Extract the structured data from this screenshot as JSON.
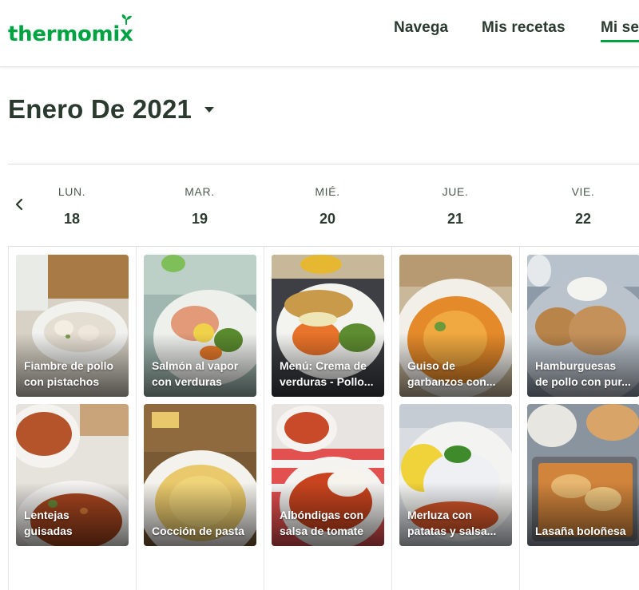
{
  "header": {
    "logo": "thermomix",
    "nav": [
      {
        "label": "Navega",
        "active": false
      },
      {
        "label": "Mis recetas",
        "active": false
      },
      {
        "label": "Mi se",
        "active": true
      }
    ]
  },
  "calendar": {
    "month_title": "Enero De 2021",
    "days": [
      {
        "name": "LUN.",
        "number": "18"
      },
      {
        "name": "MAR.",
        "number": "19"
      },
      {
        "name": "MIÉ.",
        "number": "20"
      },
      {
        "name": "JUE.",
        "number": "21"
      },
      {
        "name": "VIE.",
        "number": "22"
      }
    ],
    "recipes": [
      [
        {
          "line1": "Fiambre de pollo",
          "line2": "con pistachos"
        },
        {
          "line1": "Lentejas",
          "line2": "guisadas"
        }
      ],
      [
        {
          "line1": "Salmón al vapor",
          "line2": "con verduras"
        },
        {
          "line1": "Cocción de pasta",
          "line2": ""
        }
      ],
      [
        {
          "line1": "Menú: Crema de",
          "line2": "verduras - Pollo..."
        },
        {
          "line1": "Albóndigas con",
          "line2": "salsa de tomate"
        }
      ],
      [
        {
          "line1": "Guiso de",
          "line2": "garbanzos con..."
        },
        {
          "line1": "Merluza con",
          "line2": "patatas y salsa..."
        }
      ],
      [
        {
          "line1": "Hamburguesas",
          "line2": "de pollo con pur..."
        },
        {
          "line1": "Lasaña boloñesa",
          "line2": ""
        }
      ]
    ]
  },
  "colors": {
    "brand_green": "#00a341",
    "text_dark": "#2b3a2e"
  }
}
